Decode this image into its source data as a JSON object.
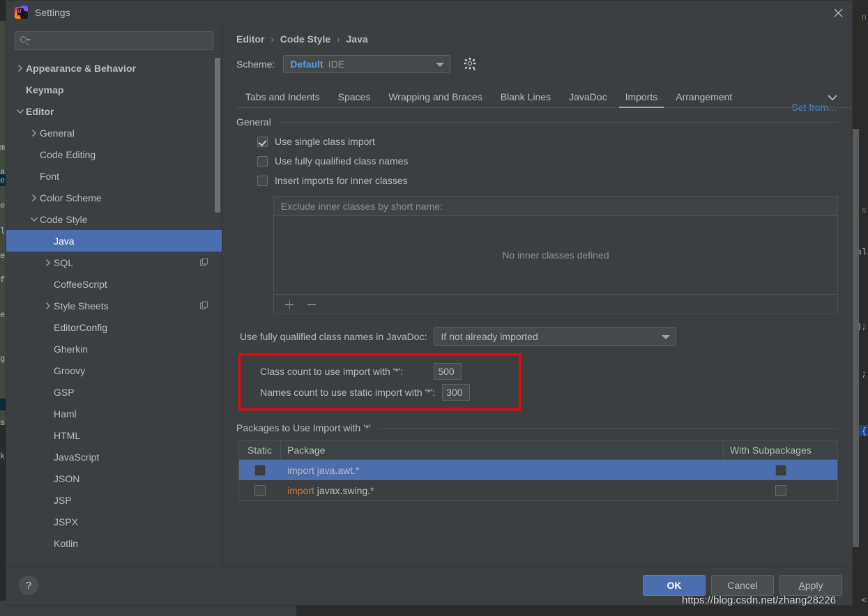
{
  "window": {
    "title": "Settings",
    "logo_icon": "intellij-idea-logo",
    "close_icon": "close-icon"
  },
  "sidebar": {
    "search": {
      "value": "",
      "placeholder": "",
      "icon": "search-icon"
    },
    "items": [
      {
        "label": "Appearance & Behavior",
        "arrow": "collapsed",
        "indent": 0,
        "bold": true,
        "selected": false,
        "copy": false
      },
      {
        "label": "Keymap",
        "arrow": "none",
        "indent": 0,
        "bold": true,
        "selected": false,
        "copy": false
      },
      {
        "label": "Editor",
        "arrow": "expanded",
        "indent": 0,
        "bold": true,
        "selected": false,
        "copy": false
      },
      {
        "label": "General",
        "arrow": "collapsed",
        "indent": 1,
        "bold": false,
        "selected": false,
        "copy": false
      },
      {
        "label": "Code Editing",
        "arrow": "none",
        "indent": 1,
        "bold": false,
        "selected": false,
        "copy": false
      },
      {
        "label": "Font",
        "arrow": "none",
        "indent": 1,
        "bold": false,
        "selected": false,
        "copy": false
      },
      {
        "label": "Color Scheme",
        "arrow": "collapsed",
        "indent": 1,
        "bold": false,
        "selected": false,
        "copy": false
      },
      {
        "label": "Code Style",
        "arrow": "expanded",
        "indent": 1,
        "bold": false,
        "selected": false,
        "copy": false
      },
      {
        "label": "Java",
        "arrow": "none",
        "indent": 2,
        "bold": false,
        "selected": true,
        "copy": false
      },
      {
        "label": "SQL",
        "arrow": "collapsed",
        "indent": 2,
        "bold": false,
        "selected": false,
        "copy": true
      },
      {
        "label": "CoffeeScript",
        "arrow": "none",
        "indent": 2,
        "bold": false,
        "selected": false,
        "copy": false
      },
      {
        "label": "Style Sheets",
        "arrow": "collapsed",
        "indent": 2,
        "bold": false,
        "selected": false,
        "copy": true
      },
      {
        "label": "EditorConfig",
        "arrow": "none",
        "indent": 2,
        "bold": false,
        "selected": false,
        "copy": false
      },
      {
        "label": "Gherkin",
        "arrow": "none",
        "indent": 2,
        "bold": false,
        "selected": false,
        "copy": false
      },
      {
        "label": "Groovy",
        "arrow": "none",
        "indent": 2,
        "bold": false,
        "selected": false,
        "copy": false
      },
      {
        "label": "GSP",
        "arrow": "none",
        "indent": 2,
        "bold": false,
        "selected": false,
        "copy": false
      },
      {
        "label": "Haml",
        "arrow": "none",
        "indent": 2,
        "bold": false,
        "selected": false,
        "copy": false
      },
      {
        "label": "HTML",
        "arrow": "none",
        "indent": 2,
        "bold": false,
        "selected": false,
        "copy": false
      },
      {
        "label": "JavaScript",
        "arrow": "none",
        "indent": 2,
        "bold": false,
        "selected": false,
        "copy": false
      },
      {
        "label": "JSON",
        "arrow": "none",
        "indent": 2,
        "bold": false,
        "selected": false,
        "copy": false
      },
      {
        "label": "JSP",
        "arrow": "none",
        "indent": 2,
        "bold": false,
        "selected": false,
        "copy": false
      },
      {
        "label": "JSPX",
        "arrow": "none",
        "indent": 2,
        "bold": false,
        "selected": false,
        "copy": false
      },
      {
        "label": "Kotlin",
        "arrow": "none",
        "indent": 2,
        "bold": false,
        "selected": false,
        "copy": false
      }
    ]
  },
  "content": {
    "breadcrumb": [
      "Editor",
      "Code Style",
      "Java"
    ],
    "breadcrumb_separator": "›",
    "scheme": {
      "label": "Scheme:",
      "value": "Default",
      "qualifier": "IDE",
      "gear_icon": "gear-icon"
    },
    "set_from_link": "Set from...",
    "tabs": [
      {
        "label": "Tabs and Indents",
        "active": false
      },
      {
        "label": "Spaces",
        "active": false
      },
      {
        "label": "Wrapping and Braces",
        "active": false
      },
      {
        "label": "Blank Lines",
        "active": false
      },
      {
        "label": "JavaDoc",
        "active": false
      },
      {
        "label": "Imports",
        "active": true
      },
      {
        "label": "Arrangement",
        "active": false
      }
    ],
    "tab_overflow_icon": "chevron-down-icon",
    "general": {
      "title": "General",
      "checkboxes": [
        {
          "label": "Use single class import",
          "checked": true
        },
        {
          "label": "Use fully qualified class names",
          "checked": false
        },
        {
          "label": "Insert imports for inner classes",
          "checked": false
        }
      ]
    },
    "exclude_panel": {
      "header": "Exclude inner classes by short name:",
      "empty_text": "No inner classes defined",
      "add_icon": "plus-icon",
      "remove_icon": "minus-icon"
    },
    "javadoc": {
      "label": "Use fully qualified class names in JavaDoc:",
      "value": "If not already imported"
    },
    "highlight": {
      "border_color": "#fe0000",
      "rows": [
        {
          "label": "Class count to use import with '*':",
          "value": "500"
        },
        {
          "label": "Names count to use static import with '*':",
          "value": "300"
        }
      ]
    },
    "packages": {
      "title": "Packages to Use Import with '*'",
      "columns": [
        "Static",
        "Package",
        "With Subpackages"
      ],
      "rows": [
        {
          "static_checked": false,
          "keyword": "import",
          "package": "java.awt.*",
          "keyword_highlighted": false,
          "sub_checked": false,
          "selected": true
        },
        {
          "static_checked": false,
          "keyword": "import",
          "package": "javax.swing.*",
          "keyword_highlighted": true,
          "sub_checked": false,
          "selected": false
        }
      ]
    }
  },
  "footer": {
    "help_icon": "question-mark-icon",
    "help_label": "?",
    "buttons": [
      {
        "label": "OK",
        "style": "primary"
      },
      {
        "label": "Cancel",
        "style": "plain"
      },
      {
        "label": "Apply",
        "style": "plain",
        "mnemonic_first": true
      }
    ]
  },
  "watermark": "https://blog.csdn.net/zhang28226",
  "colors": {
    "dialog_bg": "#3c3f41",
    "editor_bg": "#2b2b2b",
    "selection_blue": "#4b6eaf",
    "accent_link": "#4a88c7",
    "scheme_value": "#5a9de0",
    "keyword_orange": "#cc7832",
    "highlight_red": "#fe0000",
    "text": "#bbbbbb",
    "muted_text": "#8d9093"
  }
}
